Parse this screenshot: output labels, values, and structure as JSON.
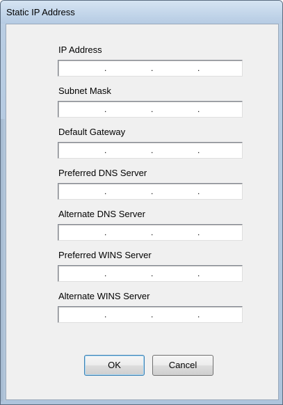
{
  "window": {
    "title": "Static IP Address"
  },
  "fields": [
    {
      "label": "IP Address",
      "value": ""
    },
    {
      "label": "Subnet Mask",
      "value": ""
    },
    {
      "label": "Default Gateway",
      "value": ""
    },
    {
      "label": "Preferred DNS Server",
      "value": ""
    },
    {
      "label": "Alternate DNS Server",
      "value": ""
    },
    {
      "label": "Preferred WINS Server",
      "value": ""
    },
    {
      "label": "Alternate WINS Server",
      "value": ""
    }
  ],
  "ip_separator": ".",
  "buttons": {
    "ok_label": "OK",
    "cancel_label": "Cancel"
  }
}
